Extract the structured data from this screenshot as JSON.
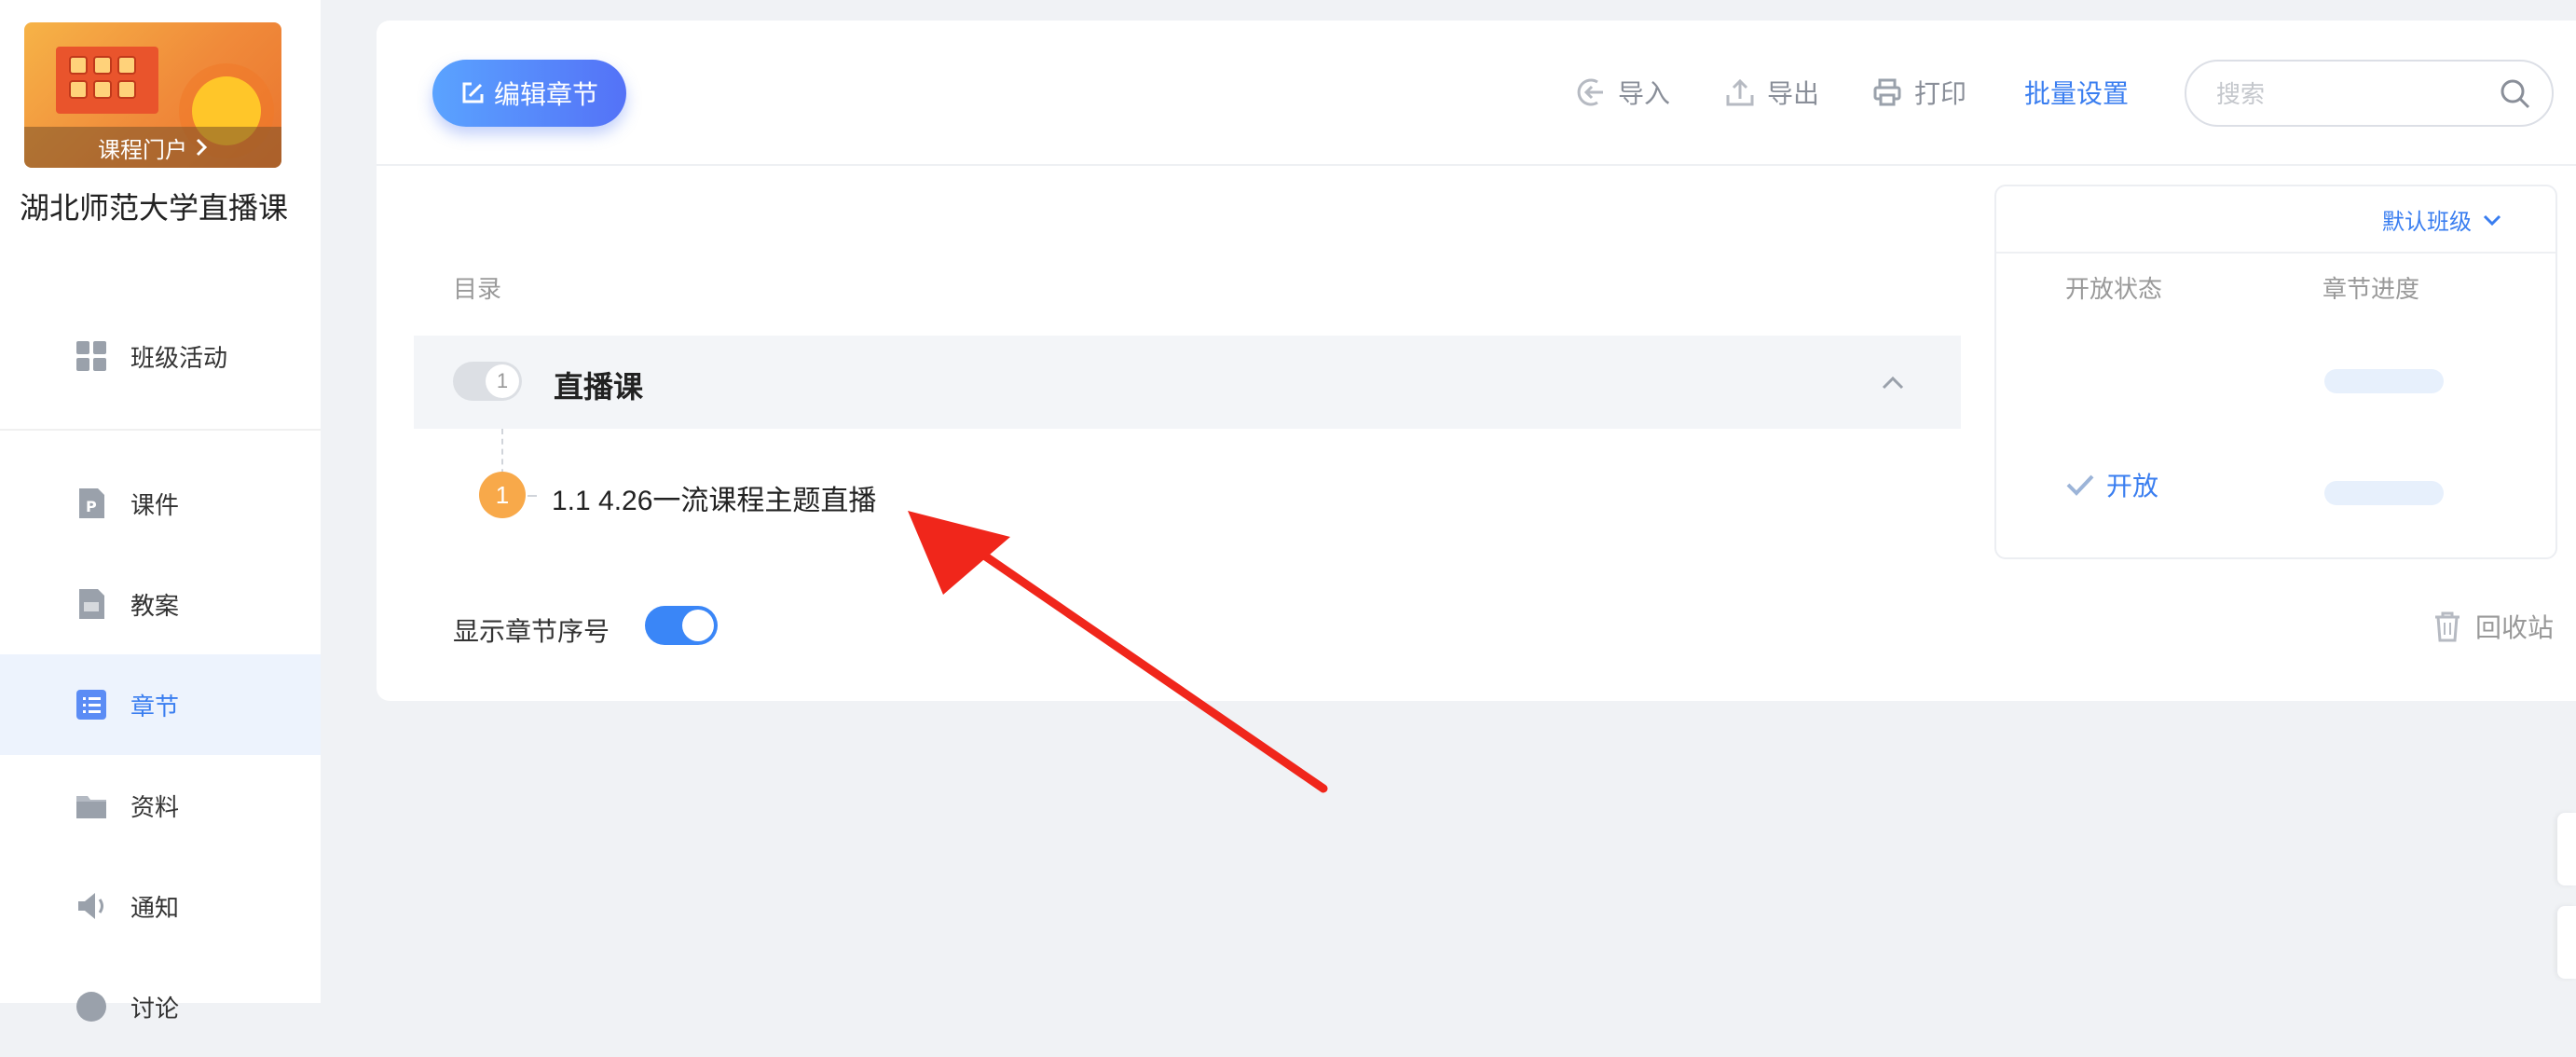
{
  "sidebar": {
    "portal_label": "课程门户",
    "course_title": "湖北师范大学直播课",
    "items": [
      {
        "label": "班级活动",
        "icon": "grid-icon"
      },
      {
        "label": "课件",
        "icon": "ppt-file-icon"
      },
      {
        "label": "教案",
        "icon": "lesson-plan-icon"
      },
      {
        "label": "章节",
        "icon": "chapter-list-icon",
        "active": true
      },
      {
        "label": "资料",
        "icon": "folder-icon"
      },
      {
        "label": "通知",
        "icon": "speaker-icon"
      },
      {
        "label": "讨论",
        "icon": "discussion-icon"
      }
    ]
  },
  "toolbar": {
    "edit_label": "编辑章节",
    "import_label": "导入",
    "export_label": "导出",
    "print_label": "打印",
    "batch_label": "批量设置",
    "search_placeholder": "搜索",
    "search_value": ""
  },
  "catalog": {
    "header": "目录",
    "chapter": {
      "number": "1",
      "title": "直播课"
    },
    "lessons": [
      {
        "number": "1",
        "title": "1.1 4.26一流课程主题直播"
      }
    ],
    "show_number_label": "显示章节序号",
    "show_number_on": true
  },
  "panel": {
    "class_select": "默认班级",
    "col_status": "开放状态",
    "col_progress": "章节进度",
    "lesson_status": "开放"
  },
  "recycle_label": "回收站",
  "colors": {
    "accent": "#3a7ef0",
    "lesson_badge": "#f8a94a",
    "annotation_arrow": "#f0261b"
  }
}
